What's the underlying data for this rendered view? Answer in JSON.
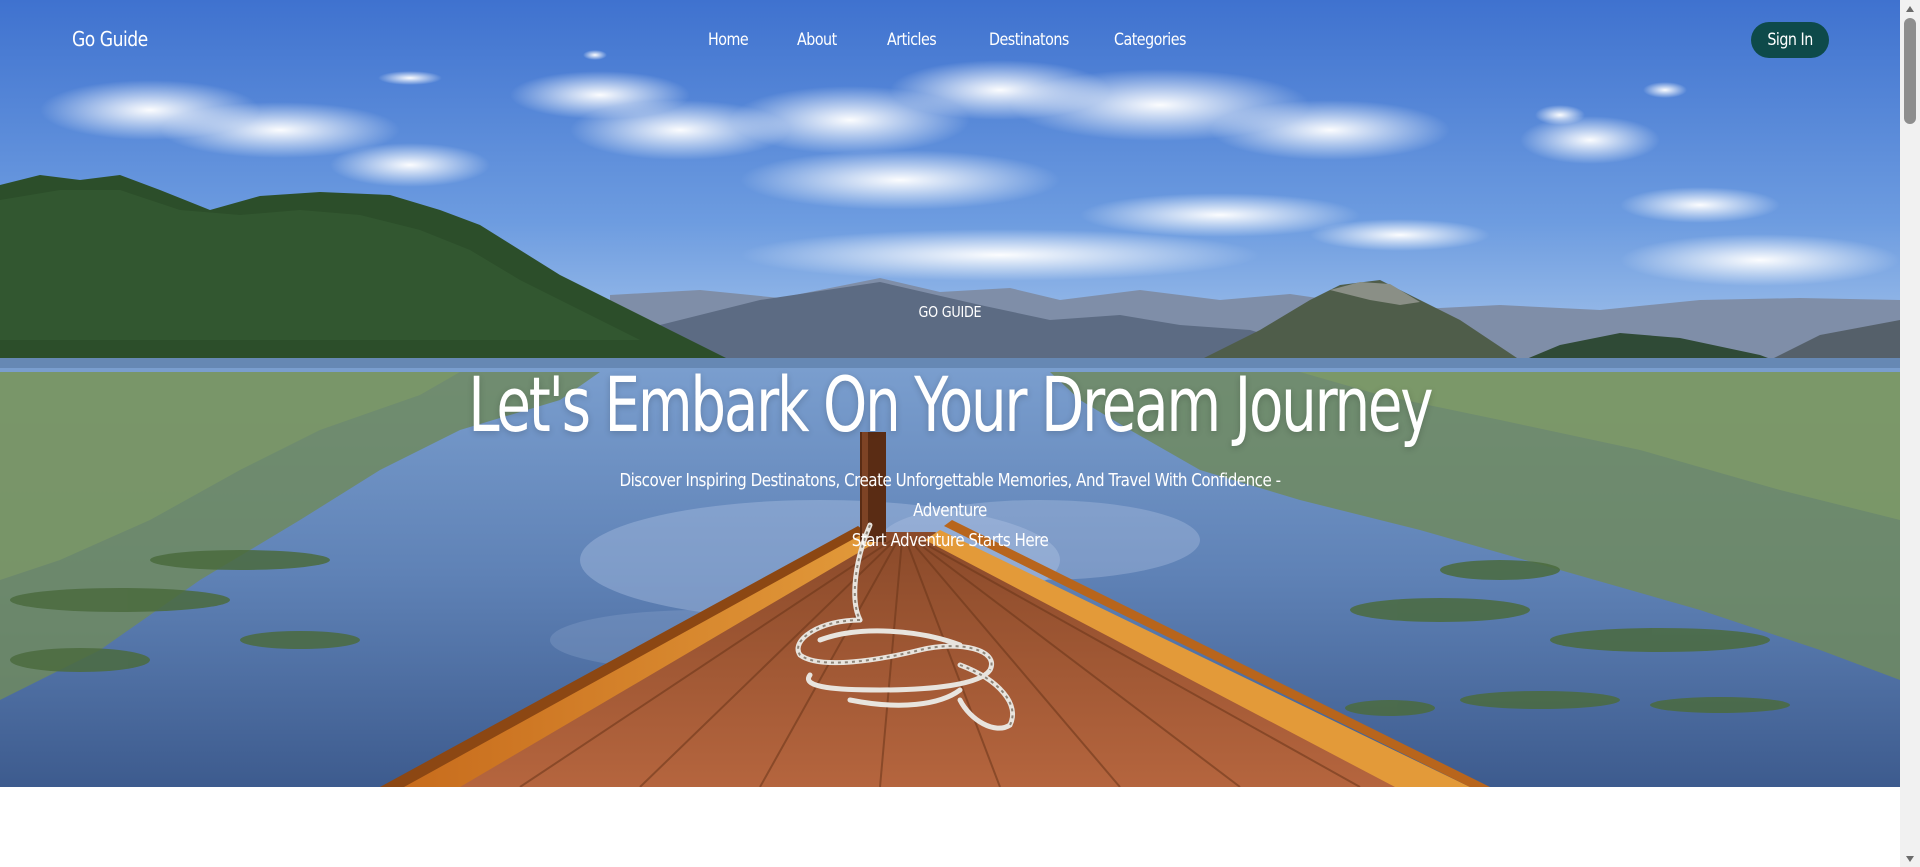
{
  "navbar": {
    "brand": "Go Guide",
    "links": [
      {
        "label": "Home"
      },
      {
        "label": "About"
      },
      {
        "label": "Articles"
      },
      {
        "label": "Destinatons"
      },
      {
        "label": "Categories"
      }
    ],
    "signin_label": "Sign In"
  },
  "hero": {
    "eyebrow": "GO GUIDE",
    "headline": "Let's Embark On Your Dream Journey",
    "subhead_line1": "Discover Inspiring Destinatons, Create Unforgettable Memories, And Travel With Confidence - Adventure",
    "subhead_line2": "Start Adventure Starts Here"
  },
  "colors": {
    "signin_background": "#0e4a4a",
    "text": "#ffffff",
    "sky": "#4f86d6",
    "lake": "#5d7fb1",
    "boat": "#d9852a"
  },
  "icons": {
    "scroll_up": "triangle-up-icon",
    "scroll_down": "triangle-down-icon"
  }
}
